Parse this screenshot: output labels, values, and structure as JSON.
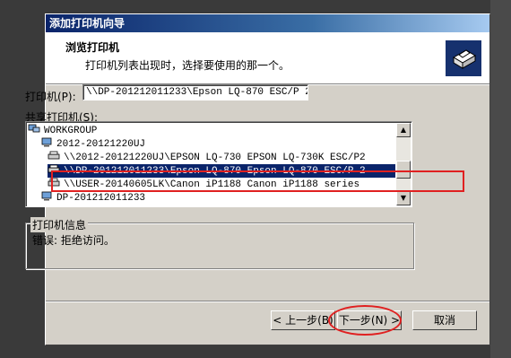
{
  "window": {
    "title": "添加打印机向导"
  },
  "header": {
    "title": "浏览打印机",
    "subtitle": "打印机列表出现时，选择要使用的那一个。",
    "icon": "printer-wizard-icon"
  },
  "printer_field": {
    "label": "打印机(P):",
    "value": "\\\\DP-201212011233\\Epson LQ-870 ESC/P 2"
  },
  "shared_printers": {
    "label": "共享打印机(S):",
    "items": [
      {
        "text": "WORKGROUP",
        "icon": "network-icon",
        "selected": false
      },
      {
        "text": "2012-20121220UJ",
        "icon": "computer-icon",
        "selected": false
      },
      {
        "text": "\\\\2012-20121220UJ\\EPSON LQ-730 EPSON LQ-730K ESC/P2",
        "icon": "printer-icon",
        "selected": false
      },
      {
        "text": "\\\\DP-201212011233\\Epson LQ-870 Epson LQ-870 ESC/P 2",
        "icon": "printer-icon",
        "selected": true
      },
      {
        "text": "\\\\USER-20140605LK\\Canon iP1188 Canon iP1188 series",
        "icon": "printer-icon",
        "selected": false
      },
      {
        "text": "DP-201212011233",
        "icon": "computer-icon",
        "selected": false
      }
    ]
  },
  "printer_info": {
    "label": "打印机信息",
    "text": "错误: 拒绝访问。"
  },
  "buttons": {
    "back": "< 上一步(B)",
    "next": "下一步(N) >",
    "cancel": "取消"
  },
  "colors": {
    "highlight": "#0a246a",
    "annotation": "#e02020"
  }
}
